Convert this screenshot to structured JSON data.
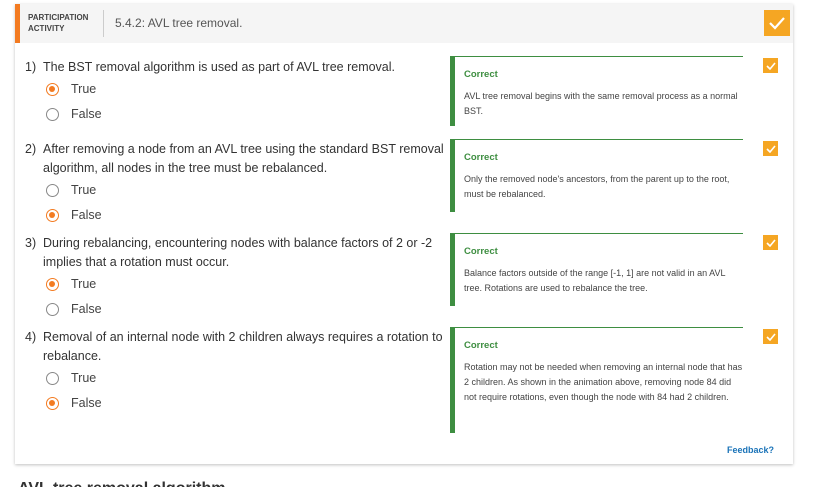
{
  "header": {
    "activity_label": "PARTICIPATION ACTIVITY",
    "title": "5.4.2: AVL tree removal."
  },
  "questions": [
    {
      "number": "1)",
      "text": "The BST removal algorithm is used as part of AVL tree removal.",
      "choices": [
        {
          "label": "True",
          "selected": true
        },
        {
          "label": "False",
          "selected": false
        }
      ],
      "feedback_title": "Correct",
      "feedback_text": "AVL tree removal begins with the same removal process as a normal BST."
    },
    {
      "number": "2)",
      "text": "After removing a node from an AVL tree using the standard BST removal algorithm, all nodes in the tree must be rebalanced.",
      "choices": [
        {
          "label": "True",
          "selected": false
        },
        {
          "label": "False",
          "selected": true
        }
      ],
      "feedback_title": "Correct",
      "feedback_text": "Only the removed node's ancestors, from the parent up to the root, must be rebalanced."
    },
    {
      "number": "3)",
      "text": "During rebalancing, encountering nodes with balance factors of 2 or -2 implies that a rotation must occur.",
      "choices": [
        {
          "label": "True",
          "selected": true
        },
        {
          "label": "False",
          "selected": false
        }
      ],
      "feedback_title": "Correct",
      "feedback_text": "Balance factors outside of the range [-1, 1] are not valid in an AVL tree. Rotations are used to rebalance the tree."
    },
    {
      "number": "4)",
      "text": "Removal of an internal node with 2 children always requires a rotation to rebalance.",
      "choices": [
        {
          "label": "True",
          "selected": false
        },
        {
          "label": "False",
          "selected": true
        }
      ],
      "feedback_title": "Correct",
      "feedback_text": "Rotation may not be needed when removing an internal node that has 2 children. As shown in the animation above, removing node 84 did not require rotations, even though the node with 84 had 2 children."
    }
  ],
  "feedback_link": "Feedback?",
  "below_heading": "AVL tree removal algorithm",
  "colors": {
    "accent": "#f37b21",
    "check": "#f5a623",
    "correct": "#3e8e41",
    "link": "#1a73b8"
  },
  "icons": {
    "completed": "checkmark-icon"
  }
}
